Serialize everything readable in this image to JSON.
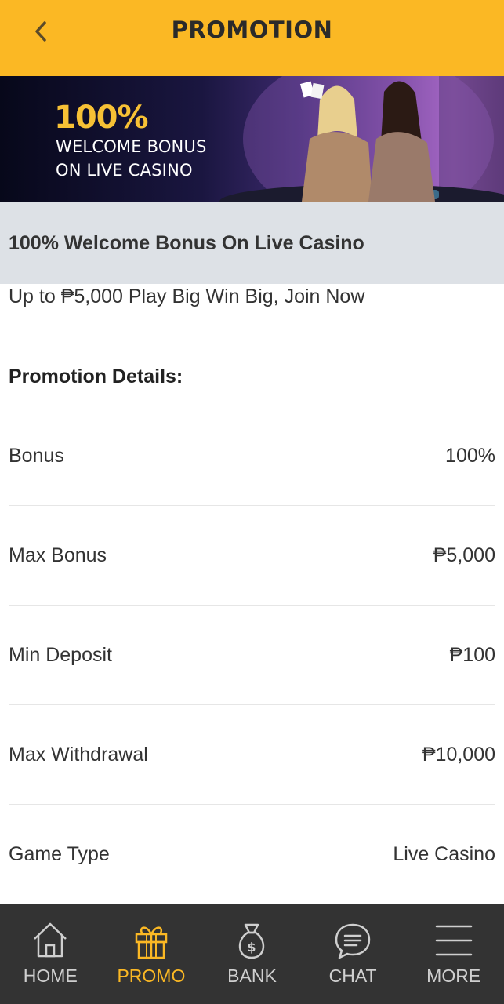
{
  "header": {
    "title": "PROMOTION",
    "back_icon": "chevron-left-icon"
  },
  "banner": {
    "headline": "100%",
    "line1": "WELCOME BONUS",
    "line2": "ON LIVE CASINO"
  },
  "promo": {
    "title": "100% Welcome Bonus On Live Casino",
    "subtitle": "Up to ₱5,000 Play Big Win Big, Join Now",
    "details_heading": "Promotion Details:",
    "details": [
      {
        "label": "Bonus",
        "value": "100%"
      },
      {
        "label": "Max Bonus",
        "value": "₱5,000"
      },
      {
        "label": "Min Deposit",
        "value": "₱100"
      },
      {
        "label": "Max Withdrawal",
        "value": "₱10,000"
      },
      {
        "label": "Game Type",
        "value": "Live Casino"
      }
    ]
  },
  "nav": {
    "items": [
      {
        "label": "HOME",
        "icon": "home-icon",
        "active": false
      },
      {
        "label": "PROMO",
        "icon": "gift-icon",
        "active": true
      },
      {
        "label": "BANK",
        "icon": "money-bag-icon",
        "active": false
      },
      {
        "label": "CHAT",
        "icon": "chat-bubble-icon",
        "active": false
      },
      {
        "label": "MORE",
        "icon": "menu-icon",
        "active": false
      }
    ]
  },
  "colors": {
    "accent": "#fbb824",
    "nav_bg": "#333333",
    "title_bar_bg": "#dde1e6"
  }
}
